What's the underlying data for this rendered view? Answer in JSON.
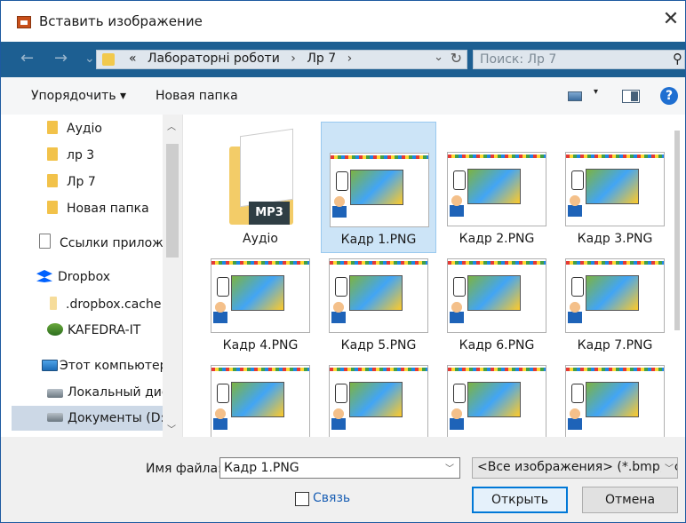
{
  "window": {
    "title": "Вставить изображение",
    "close_glyph": "✕"
  },
  "nav": {
    "back": "←",
    "forward": "→",
    "recent": "⌄",
    "address": {
      "prefix": "«",
      "crumbs": [
        "Лабораторні роботи",
        "Лр 7"
      ],
      "separator": "›"
    },
    "search_placeholder": "Поиск: Лр 7"
  },
  "toolbar": {
    "organize_label": "Упорядочить ▾",
    "new_folder_label": "Новая папка",
    "help_label": "?"
  },
  "sidebar": {
    "items": [
      {
        "label": "Аудіо",
        "icon": "folder-icon"
      },
      {
        "label": "лр 3",
        "icon": "folder-icon"
      },
      {
        "label": "Лр 7",
        "icon": "folder-icon"
      },
      {
        "label": "Новая папка",
        "icon": "folder-icon"
      },
      {
        "label": "Ссылки приложен",
        "icon": "document-icon"
      },
      {
        "label": "Dropbox",
        "icon": "dropbox-icon"
      },
      {
        "label": ".dropbox.cache",
        "icon": "folder-icon"
      },
      {
        "label": "KAFEDRA-IT",
        "icon": "network-icon"
      },
      {
        "label": "Этот компьютер",
        "icon": "computer-icon"
      },
      {
        "label": "Локальный диск",
        "icon": "disk-icon"
      },
      {
        "label": "Документы (D:)",
        "icon": "disk-icon",
        "selected": true
      }
    ]
  },
  "files": [
    {
      "name": "Аудіо",
      "type": "folder",
      "badge": "MP3"
    },
    {
      "name": "Кадр 1.PNG",
      "type": "image",
      "selected": true
    },
    {
      "name": "Кадр 2.PNG",
      "type": "image"
    },
    {
      "name": "Кадр 3.PNG",
      "type": "image"
    },
    {
      "name": "Кадр 4.PNG",
      "type": "image"
    },
    {
      "name": "Кадр 5.PNG",
      "type": "image"
    },
    {
      "name": "Кадр 6.PNG",
      "type": "image"
    },
    {
      "name": "Кадр 7.PNG",
      "type": "image"
    },
    {
      "name": "",
      "type": "image"
    },
    {
      "name": "",
      "type": "image"
    },
    {
      "name": "",
      "type": "image"
    },
    {
      "name": "",
      "type": "image"
    }
  ],
  "footer": {
    "filename_label": "Имя файла:",
    "filename_value": "Кадр 1.PNG",
    "filter_value": "<Все изображения> (*.bmp;*.c",
    "link_label": "Связь",
    "link_checked": false,
    "open_label": "Открыть",
    "cancel_label": "Отмена"
  },
  "colors": {
    "navbar": "#1d5f92",
    "selection": "#cce4f7",
    "accent": "#0078d7"
  }
}
